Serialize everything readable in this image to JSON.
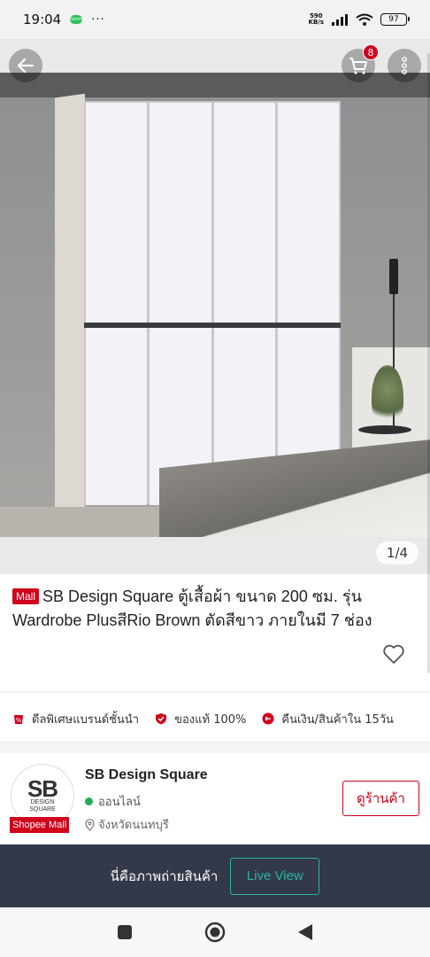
{
  "status_bar": {
    "time": "19:04",
    "fresh_label": "Gmm",
    "dots": "···",
    "net_speed_value": "590",
    "net_speed_unit": "KB/s",
    "battery": "97"
  },
  "hero": {
    "cart_count": "8",
    "image_counter": "1/4"
  },
  "product": {
    "mall_tag": "Mall",
    "title": "SB Design Square ตู้เสื้อผ้า ขนาด 200 ซม. รุ่น Wardrobe PlusสีRio Brown ตัดสีขาว ภายในมี 7 ช่อง"
  },
  "guarantees": [
    {
      "label": "ดีลพิเศษแบรนด์ชั้นนำ",
      "icon": "sale-tag-icon"
    },
    {
      "label": "ของแท้ 100%",
      "icon": "shield-check-icon"
    },
    {
      "label": "คืนเงิน/สินค้าใน 15วัน",
      "icon": "return-icon"
    }
  ],
  "shop": {
    "logo_main": "SB",
    "logo_sub1": "DESIGN",
    "logo_sub2": "SQUARE",
    "badge": "Shopee Mall",
    "name": "SB Design Square",
    "status": "ออนไลน์",
    "location": "จังหวัดนนทบุรี",
    "visit_label": "ดูร้านค้า"
  },
  "live_view": {
    "text": "นี่คือภาพถ่ายสินค้า",
    "button_label": "Live View"
  },
  "colors": {
    "brand_red": "#d0011b",
    "online_green": "#26aa55",
    "live_teal": "#26b5a4",
    "live_bar_bg": "#333948"
  }
}
